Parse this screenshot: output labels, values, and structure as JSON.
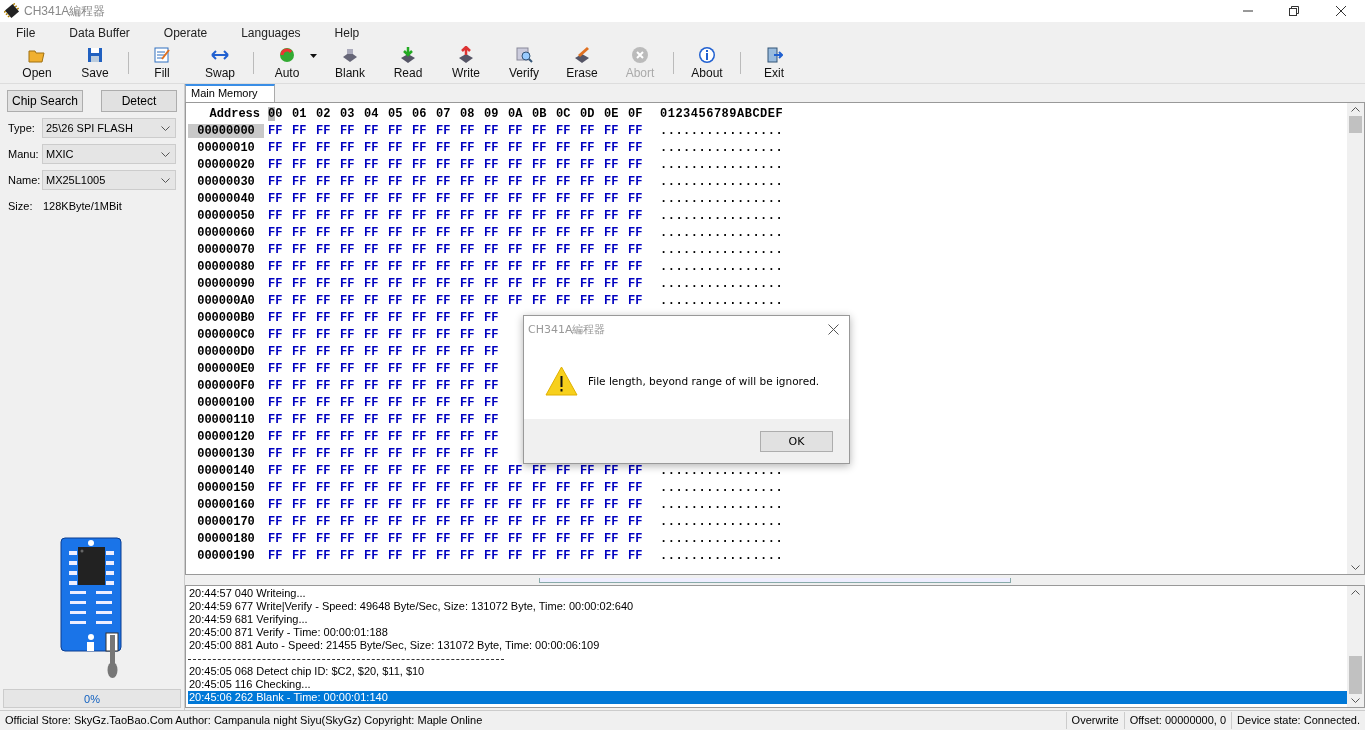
{
  "window": {
    "title": "CH341A編程器"
  },
  "menu": [
    "File",
    "Data Buffer",
    "Operate",
    "Languages",
    "Help"
  ],
  "toolbar": [
    {
      "kind": "button",
      "label": "Open",
      "disabled": false
    },
    {
      "kind": "button",
      "label": "Save",
      "disabled": false
    },
    {
      "kind": "separator"
    },
    {
      "kind": "button",
      "label": "Fill",
      "disabled": false
    },
    {
      "kind": "button",
      "label": "Swap",
      "disabled": false
    },
    {
      "kind": "separator"
    },
    {
      "kind": "button",
      "label": "Auto",
      "disabled": false,
      "dropdown": true
    },
    {
      "kind": "button",
      "label": "Blank",
      "disabled": false
    },
    {
      "kind": "button",
      "label": "Read",
      "disabled": false
    },
    {
      "kind": "button",
      "label": "Write",
      "disabled": false
    },
    {
      "kind": "button",
      "label": "Verify",
      "disabled": false
    },
    {
      "kind": "button",
      "label": "Erase",
      "disabled": false
    },
    {
      "kind": "button",
      "label": "Abort",
      "disabled": true
    },
    {
      "kind": "separator"
    },
    {
      "kind": "button",
      "label": "About",
      "disabled": false
    },
    {
      "kind": "separator"
    },
    {
      "kind": "button",
      "label": "Exit",
      "disabled": false
    }
  ],
  "chip_panel": {
    "buttons": [
      "Chip Search",
      "Detect"
    ],
    "fields": [
      {
        "label": "Type:",
        "value": "25\\26 SPI FLASH"
      },
      {
        "label": "Manu:",
        "value": "MXIC"
      },
      {
        "label": "Name:",
        "value": "MX25L1005"
      }
    ],
    "size": {
      "label": "Size:",
      "value": "128KByte/1MBit"
    },
    "progress": {
      "level": 0,
      "reading": "0%"
    }
  },
  "tabs": [
    {
      "label": "Main Memory",
      "selected": true
    }
  ],
  "hex_view": {
    "address_header": "Address",
    "columns": [
      "00",
      "01",
      "02",
      "03",
      "04",
      "05",
      "06",
      "07",
      "08",
      "09",
      "0A",
      "0B",
      "0C",
      "0D",
      "0E",
      "0F"
    ],
    "ascii_header": "0123456789ABCDEF",
    "rows": [
      {
        "address": "00000000",
        "selected": true,
        "bytes": [
          "FF",
          "FF",
          "FF",
          "FF",
          "FF",
          "FF",
          "FF",
          "FF",
          "FF",
          "FF",
          "FF",
          "FF",
          "FF",
          "FF",
          "FF",
          "FF"
        ],
        "ascii": "................"
      },
      {
        "address": "00000010",
        "selected": false,
        "bytes": [
          "FF",
          "FF",
          "FF",
          "FF",
          "FF",
          "FF",
          "FF",
          "FF",
          "FF",
          "FF",
          "FF",
          "FF",
          "FF",
          "FF",
          "FF",
          "FF"
        ],
        "ascii": "................"
      },
      {
        "address": "00000020",
        "selected": false,
        "bytes": [
          "FF",
          "FF",
          "FF",
          "FF",
          "FF",
          "FF",
          "FF",
          "FF",
          "FF",
          "FF",
          "FF",
          "FF",
          "FF",
          "FF",
          "FF",
          "FF"
        ],
        "ascii": "................"
      },
      {
        "address": "00000030",
        "selected": false,
        "bytes": [
          "FF",
          "FF",
          "FF",
          "FF",
          "FF",
          "FF",
          "FF",
          "FF",
          "FF",
          "FF",
          "FF",
          "FF",
          "FF",
          "FF",
          "FF",
          "FF"
        ],
        "ascii": "................"
      },
      {
        "address": "00000040",
        "selected": false,
        "bytes": [
          "FF",
          "FF",
          "FF",
          "FF",
          "FF",
          "FF",
          "FF",
          "FF",
          "FF",
          "FF",
          "FF",
          "FF",
          "FF",
          "FF",
          "FF",
          "FF"
        ],
        "ascii": "................"
      },
      {
        "address": "00000050",
        "selected": false,
        "bytes": [
          "FF",
          "FF",
          "FF",
          "FF",
          "FF",
          "FF",
          "FF",
          "FF",
          "FF",
          "FF",
          "FF",
          "FF",
          "FF",
          "FF",
          "FF",
          "FF"
        ],
        "ascii": "................"
      },
      {
        "address": "00000060",
        "selected": false,
        "bytes": [
          "FF",
          "FF",
          "FF",
          "FF",
          "FF",
          "FF",
          "FF",
          "FF",
          "FF",
          "FF",
          "FF",
          "FF",
          "FF",
          "FF",
          "FF",
          "FF"
        ],
        "ascii": "................"
      },
      {
        "address": "00000070",
        "selected": false,
        "bytes": [
          "FF",
          "FF",
          "FF",
          "FF",
          "FF",
          "FF",
          "FF",
          "FF",
          "FF",
          "FF",
          "FF",
          "FF",
          "FF",
          "FF",
          "FF",
          "FF"
        ],
        "ascii": "................"
      },
      {
        "address": "00000080",
        "selected": false,
        "bytes": [
          "FF",
          "FF",
          "FF",
          "FF",
          "FF",
          "FF",
          "FF",
          "FF",
          "FF",
          "FF",
          "FF",
          "FF",
          "FF",
          "FF",
          "FF",
          "FF"
        ],
        "ascii": "................"
      },
      {
        "address": "00000090",
        "selected": false,
        "bytes": [
          "FF",
          "FF",
          "FF",
          "FF",
          "FF",
          "FF",
          "FF",
          "FF",
          "FF",
          "FF",
          "FF",
          "FF",
          "FF",
          "FF",
          "FF",
          "FF"
        ],
        "ascii": "................"
      },
      {
        "address": "000000A0",
        "selected": false,
        "bytes": [
          "FF",
          "FF",
          "FF",
          "FF",
          "FF",
          "FF",
          "FF",
          "FF",
          "FF",
          "FF",
          "FF",
          "FF",
          "FF",
          "FF",
          "FF",
          "FF"
        ],
        "ascii": "................"
      },
      {
        "address": "000000B0",
        "selected": false,
        "bytes": [
          "FF",
          "FF",
          "FF",
          "FF",
          "FF",
          "FF",
          "FF",
          "FF",
          "FF",
          "FF"
        ]
      },
      {
        "address": "000000C0",
        "selected": false,
        "bytes": [
          "FF",
          "FF",
          "FF",
          "FF",
          "FF",
          "FF",
          "FF",
          "FF",
          "FF",
          "FF"
        ]
      },
      {
        "address": "000000D0",
        "selected": false,
        "bytes": [
          "FF",
          "FF",
          "FF",
          "FF",
          "FF",
          "FF",
          "FF",
          "FF",
          "FF",
          "FF"
        ]
      },
      {
        "address": "000000E0",
        "selected": false,
        "bytes": [
          "FF",
          "FF",
          "FF",
          "FF",
          "FF",
          "FF",
          "FF",
          "FF",
          "FF",
          "FF"
        ]
      },
      {
        "address": "000000F0",
        "selected": false,
        "bytes": [
          "FF",
          "FF",
          "FF",
          "FF",
          "FF",
          "FF",
          "FF",
          "FF",
          "FF",
          "FF"
        ]
      },
      {
        "address": "00000100",
        "selected": false,
        "bytes": [
          "FF",
          "FF",
          "FF",
          "FF",
          "FF",
          "FF",
          "FF",
          "FF",
          "FF",
          "FF"
        ]
      },
      {
        "address": "00000110",
        "selected": false,
        "bytes": [
          "FF",
          "FF",
          "FF",
          "FF",
          "FF",
          "FF",
          "FF",
          "FF",
          "FF",
          "FF"
        ]
      },
      {
        "address": "00000120",
        "selected": false,
        "bytes": [
          "FF",
          "FF",
          "FF",
          "FF",
          "FF",
          "FF",
          "FF",
          "FF",
          "FF",
          "FF"
        ]
      },
      {
        "address": "00000130",
        "selected": false,
        "bytes": [
          "FF",
          "FF",
          "FF",
          "FF",
          "FF",
          "FF",
          "FF",
          "FF",
          "FF",
          "FF"
        ]
      },
      {
        "address": "00000140",
        "selected": false,
        "bytes": [
          "FF",
          "FF",
          "FF",
          "FF",
          "FF",
          "FF",
          "FF",
          "FF",
          "FF",
          "FF",
          "FF",
          "FF",
          "FF",
          "FF",
          "FF",
          "FF"
        ],
        "ascii": "................"
      },
      {
        "address": "00000150",
        "selected": false,
        "bytes": [
          "FF",
          "FF",
          "FF",
          "FF",
          "FF",
          "FF",
          "FF",
          "FF",
          "FF",
          "FF",
          "FF",
          "FF",
          "FF",
          "FF",
          "FF",
          "FF"
        ],
        "ascii": "................"
      },
      {
        "address": "00000160",
        "selected": false,
        "bytes": [
          "FF",
          "FF",
          "FF",
          "FF",
          "FF",
          "FF",
          "FF",
          "FF",
          "FF",
          "FF",
          "FF",
          "FF",
          "FF",
          "FF",
          "FF",
          "FF"
        ],
        "ascii": "................"
      },
      {
        "address": "00000170",
        "selected": false,
        "bytes": [
          "FF",
          "FF",
          "FF",
          "FF",
          "FF",
          "FF",
          "FF",
          "FF",
          "FF",
          "FF",
          "FF",
          "FF",
          "FF",
          "FF",
          "FF",
          "FF"
        ],
        "ascii": "................"
      },
      {
        "address": "00000180",
        "selected": false,
        "bytes": [
          "FF",
          "FF",
          "FF",
          "FF",
          "FF",
          "FF",
          "FF",
          "FF",
          "FF",
          "FF",
          "FF",
          "FF",
          "FF",
          "FF",
          "FF",
          "FF"
        ],
        "ascii": "................"
      },
      {
        "address": "00000190",
        "selected": false,
        "bytes": [
          "FF",
          "FF",
          "FF",
          "FF",
          "FF",
          "FF",
          "FF",
          "FF",
          "FF",
          "FF",
          "FF",
          "FF",
          "FF",
          "FF",
          "FF",
          "FF"
        ],
        "ascii": "................"
      }
    ]
  },
  "log": [
    {
      "kind": "text",
      "text": "20:44:57 040 Writeing...",
      "selected": false
    },
    {
      "kind": "text",
      "text": "20:44:59 677 Write|Verify - Speed: 49648 Byte/Sec, Size: 131072 Byte, Time: 00:00:02:640",
      "selected": false
    },
    {
      "kind": "text",
      "text": "20:44:59 681 Verifying...",
      "selected": false
    },
    {
      "kind": "text",
      "text": "20:45:00 871 Verify - Time: 00:00:01:188",
      "selected": false
    },
    {
      "kind": "text",
      "text": "20:45:00 881 Auto - Speed: 21455 Byte/Sec, Size: 131072 Byte, Time: 00:00:06:109",
      "selected": false
    },
    {
      "kind": "divider"
    },
    {
      "kind": "text",
      "text": "20:45:05 068 Detect chip ID: $C2, $20, $11, $10",
      "selected": false
    },
    {
      "kind": "text",
      "text": "20:45:05 116 Checking...",
      "selected": false
    },
    {
      "kind": "text",
      "text": "20:45:06 262 Blank - Time: 00:00:01:140",
      "selected": true
    }
  ],
  "status_bar": [
    "Official Store: SkyGz.TaoBao.Com Author: Campanula night Siyu(SkyGz) Copyright: Maple Online",
    "Overwrite",
    "Offset: 00000000, 0",
    "Device state: Connected."
  ],
  "dialog": {
    "title": "CH341A編程器",
    "message": "File length, beyond range of will be ignored.",
    "button": "OK"
  }
}
